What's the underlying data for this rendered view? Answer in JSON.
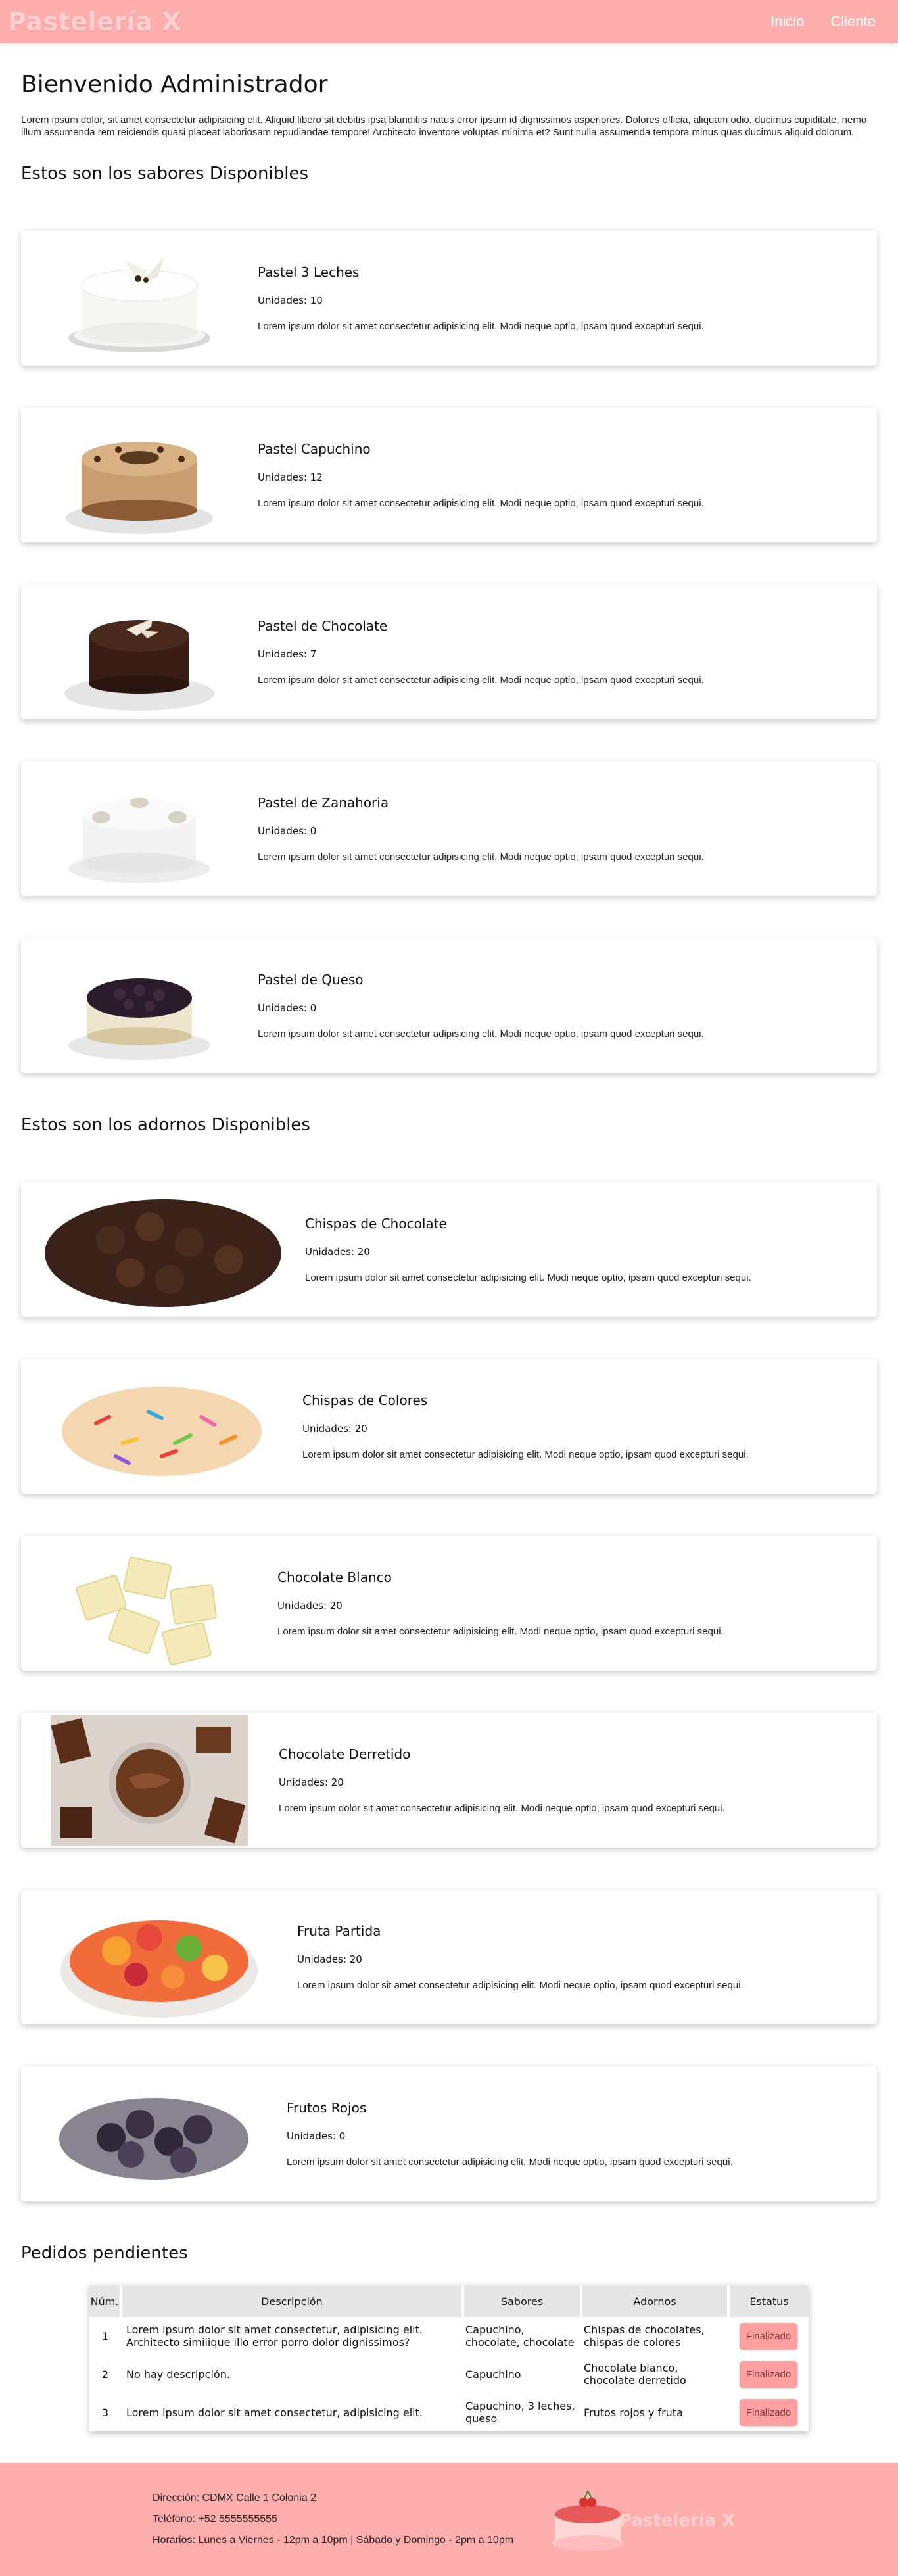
{
  "brand": {
    "name": "Pastelería X"
  },
  "nav": {
    "inicio": "Inicio",
    "cliente": "Cliente"
  },
  "welcome": {
    "title": "Bienvenido Administrador",
    "intro": "Lorem ipsum dolor, sit amet consectetur adipisicing elit. Aliquid libero sit debitis ipsa blanditiis natus error ipsum id dignissimos asperiores. Dolores officia, aliquam odio, ducimus cupiditate, nemo illum assumenda rem reiciendis quasi placeat laboriosam repudiandae tempore! Architecto inventore voluptas minima et? Sunt nulla assumenda tempora minus quas ducimus aliquid dolorum."
  },
  "sabores": {
    "title": "Estos son los sabores Disponibles",
    "items": [
      {
        "name": "Pastel 3 Leches",
        "units": "Unidades: 10",
        "desc": "Lorem ipsum dolor sit amet consectetur adipisicing elit. Modi neque optio, ipsam quod excepturi sequi."
      },
      {
        "name": "Pastel Capuchino",
        "units": "Unidades: 12",
        "desc": "Lorem ipsum dolor sit amet consectetur adipisicing elit. Modi neque optio, ipsam quod excepturi sequi."
      },
      {
        "name": "Pastel de Chocolate",
        "units": "Unidades: 7",
        "desc": "Lorem ipsum dolor sit amet consectetur adipisicing elit. Modi neque optio, ipsam quod excepturi sequi."
      },
      {
        "name": "Pastel de Zanahoria",
        "units": "Unidades: 0",
        "desc": "Lorem ipsum dolor sit amet consectetur adipisicing elit. Modi neque optio, ipsam quod excepturi sequi."
      },
      {
        "name": "Pastel de Queso",
        "units": "Unidades: 0",
        "desc": "Lorem ipsum dolor sit amet consectetur adipisicing elit. Modi neque optio, ipsam quod excepturi sequi."
      }
    ]
  },
  "adornos": {
    "title": "Estos son los adornos Disponibles",
    "items": [
      {
        "name": "Chispas de Chocolate",
        "units": "Unidades: 20",
        "desc": "Lorem ipsum dolor sit amet consectetur adipisicing elit. Modi neque optio, ipsam quod excepturi sequi."
      },
      {
        "name": "Chispas de Colores",
        "units": "Unidades: 20",
        "desc": "Lorem ipsum dolor sit amet consectetur adipisicing elit. Modi neque optio, ipsam quod excepturi sequi."
      },
      {
        "name": "Chocolate Blanco",
        "units": "Unidades: 20",
        "desc": "Lorem ipsum dolor sit amet consectetur adipisicing elit. Modi neque optio, ipsam quod excepturi sequi."
      },
      {
        "name": "Chocolate Derretido",
        "units": "Unidades: 20",
        "desc": "Lorem ipsum dolor sit amet consectetur adipisicing elit. Modi neque optio, ipsam quod excepturi sequi."
      },
      {
        "name": "Fruta Partida",
        "units": "Unidades: 20",
        "desc": "Lorem ipsum dolor sit amet consectetur adipisicing elit. Modi neque optio, ipsam quod excepturi sequi."
      },
      {
        "name": "Frutos Rojos",
        "units": "Unidades: 0",
        "desc": "Lorem ipsum dolor sit amet consectetur adipisicing elit. Modi neque optio, ipsam quod excepturi sequi."
      }
    ]
  },
  "pedidos": {
    "title": "Pedidos pendientes",
    "headers": {
      "num": "Núm.",
      "desc": "Descripción",
      "sabores": "Sabores",
      "adornos": "Adornos",
      "estatus": "Estatus"
    },
    "rows": [
      {
        "num": "1",
        "desc": "Lorem ipsum dolor sit amet consectetur, adipisicing elit. Architecto similique illo error porro dolor dignissimos?",
        "sabores": "Capuchino, chocolate, chocolate",
        "adornos": "Chispas de chocolates, chispas de colores",
        "estatus": "Finalizado"
      },
      {
        "num": "2",
        "desc": "No hay descripción.",
        "sabores": "Capuchino",
        "adornos": "Chocolate blanco, chocolate derretido",
        "estatus": "Finalizado"
      },
      {
        "num": "3",
        "desc": "Lorem ipsum dolor sit amet consectetur, adipisicing elit.",
        "sabores": "Capuchino, 3 leches, queso",
        "adornos": "Frutos rojos y fruta",
        "estatus": "Finalizado"
      }
    ]
  },
  "footer": {
    "direccion": "Dirección: CDMX Calle 1 Colonia 2",
    "telefono": "Teléfono: +52 5555555555",
    "horarios": "Horarios: Lunes a Viernes - 12pm a 10pm | Sábado y Domingo - 2pm a 10pm",
    "brand": "Pastelería X"
  },
  "colors": {
    "primary": "#ffaeae",
    "button": "#ff9f9f"
  }
}
